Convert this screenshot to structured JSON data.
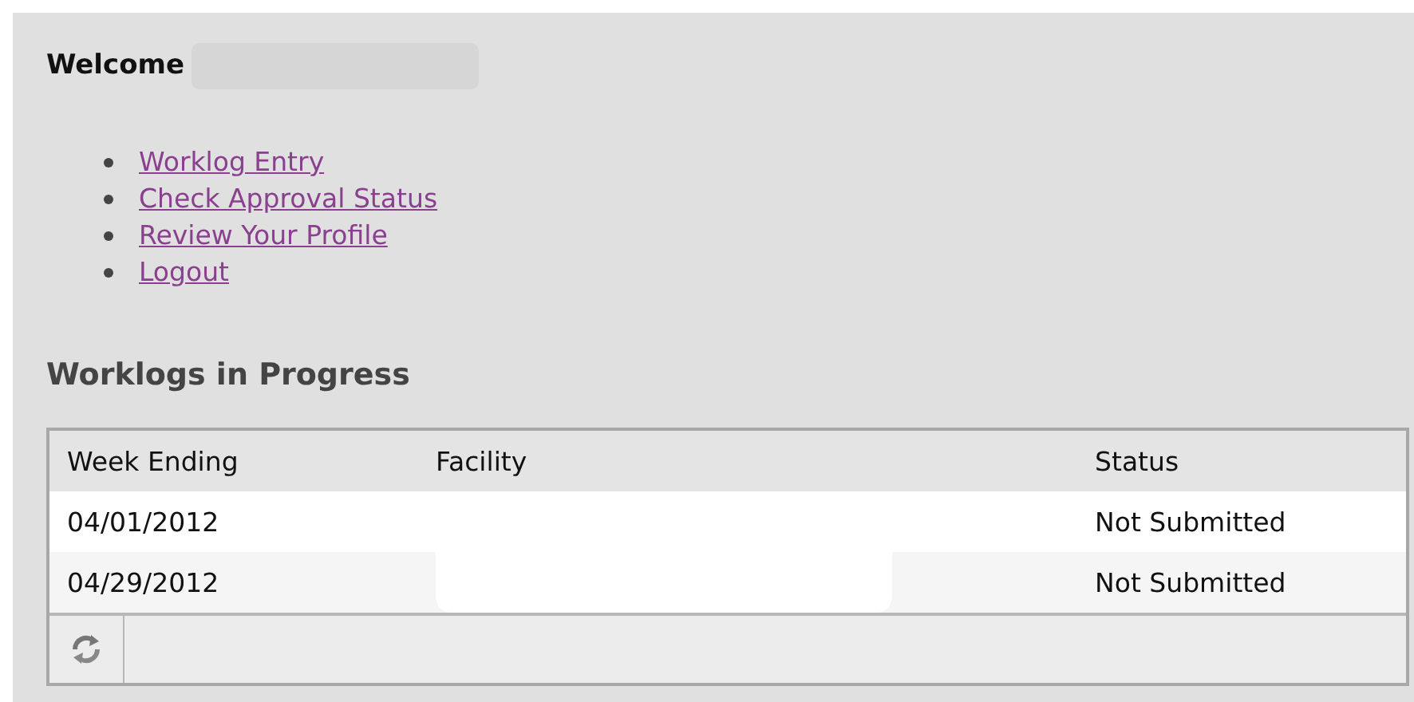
{
  "welcome": {
    "label": "Welcome"
  },
  "links": [
    {
      "label": "Worklog Entry"
    },
    {
      "label": "Check Approval Status"
    },
    {
      "label": "Review Your Profile"
    },
    {
      "label": "Logout"
    }
  ],
  "section_title": "Worklogs in Progress",
  "table": {
    "columns": [
      "Week Ending",
      "Facility",
      "Status"
    ],
    "rows": [
      {
        "week_ending": "04/01/2012",
        "status": "Not Submitted"
      },
      {
        "week_ending": "04/29/2012",
        "status": "Not Submitted"
      }
    ]
  }
}
